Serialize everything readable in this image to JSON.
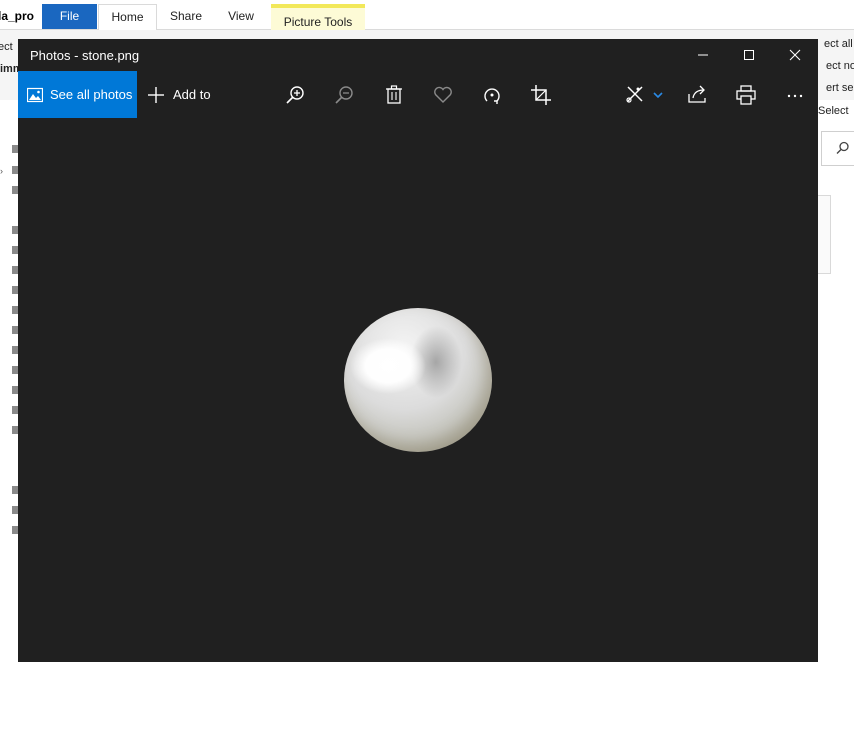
{
  "explorer": {
    "title_fragment": "la_pro",
    "tabs": [
      "File",
      "Home",
      "Share",
      "View",
      "Picture Tools"
    ],
    "left_fragments": [
      "ect",
      "imm"
    ],
    "right_select_items": [
      "ect all",
      "ect non",
      "ert selec",
      "Select"
    ]
  },
  "photos": {
    "title": "Photos - stone.png",
    "see_all_label": "See all photos",
    "add_to_label": "Add to",
    "toolbar_icons": [
      "zoom-in-icon",
      "zoom-out-icon",
      "delete-icon",
      "favorite-icon",
      "rotate-icon",
      "crop-icon",
      "edit-icon",
      "share-icon",
      "print-icon",
      "more-icon"
    ],
    "accent_color": "#0078d7",
    "background_color": "#202020"
  }
}
